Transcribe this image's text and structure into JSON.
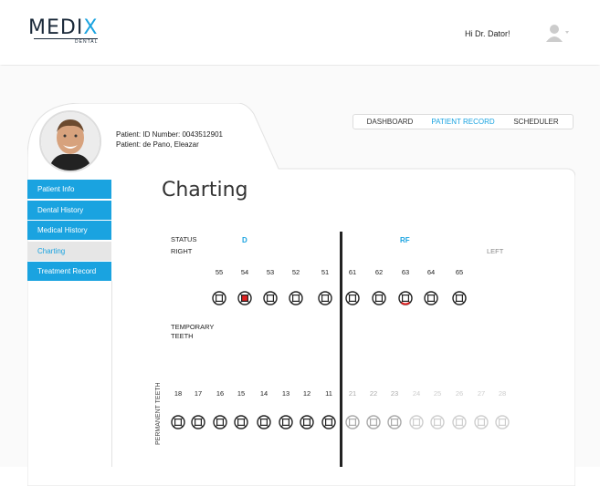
{
  "header": {
    "logo_text": "MEDIX",
    "logo_sub": "DENTAL",
    "greeting": "Hi Dr. Dator!"
  },
  "patient": {
    "id_line": "Patient: ID Number: 0043512901",
    "name_line": "Patient: de Pano, Eleazar"
  },
  "tabs": [
    {
      "label": "DASHBOARD"
    },
    {
      "label": "PATIENT RECORD"
    },
    {
      "label": "SCHEDULER"
    }
  ],
  "active_tab": "PATIENT RECORD",
  "sidebar": {
    "items": [
      {
        "label": "Patient Info"
      },
      {
        "label": "Dental History"
      },
      {
        "label": "Medical History"
      },
      {
        "label": "Charting"
      },
      {
        "label": "Treatment Record"
      }
    ],
    "active": "Charting"
  },
  "main": {
    "title": "Charting",
    "status_label": "STATUS",
    "right_label": "RIGHT",
    "left_label": "LEFT",
    "temporary_label": "TEMPORARY\nTEETH",
    "permanent_label": "PERMANENT\nTEETH",
    "status_codes": [
      {
        "code": "D",
        "tooth": "54"
      },
      {
        "code": "RF",
        "tooth": "63"
      }
    ],
    "temp_teeth": [
      "55",
      "54",
      "53",
      "52",
      "51",
      "61",
      "62",
      "63",
      "64",
      "65"
    ],
    "perm_teeth": [
      "18",
      "17",
      "16",
      "15",
      "14",
      "13",
      "12",
      "11",
      "21",
      "22",
      "23",
      "24",
      "25",
      "26",
      "27",
      "28"
    ]
  },
  "colors": {
    "accent": "#1aa3e0",
    "decay": "#e02020",
    "text": "#222222"
  }
}
